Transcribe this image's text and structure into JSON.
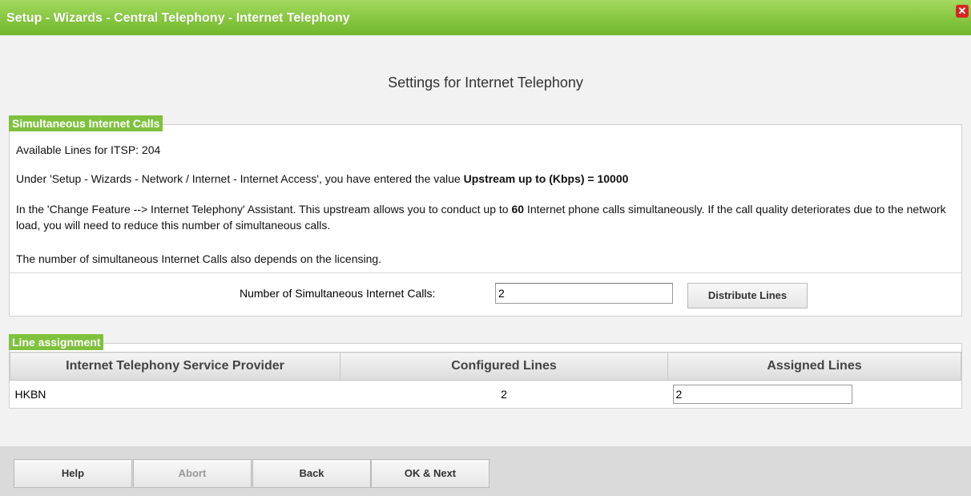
{
  "window": {
    "title": "Setup - Wizards - Central Telephony - Internet Telephony",
    "close_glyph": "✕"
  },
  "heading": "Settings for Internet Telephony",
  "simultaneous": {
    "legend": "Simultaneous Internet Calls",
    "available_lines": "Available Lines for ITSP: 204",
    "upstream_prefix": "Under 'Setup - Wizards - Network / Internet - Internet Access', you have entered the value ",
    "upstream_bold": "Upstream up to (Kbps) = 10000",
    "assistant_prefix": "In the 'Change Feature --> Internet Telephony' Assistant. This upstream allows you to conduct up to ",
    "assistant_bold": "60",
    "assistant_suffix": " Internet phone calls simultaneously. If the call quality deteriorates due to the network load, you will need to reduce this number of simultaneous calls.",
    "licensing": "The number of simultaneous Internet Calls also depends on the licensing.",
    "calls_label": "Number of Simultaneous Internet Calls:",
    "calls_value": "2",
    "distribute_label": "Distribute Lines"
  },
  "line_assignment": {
    "legend": "Line assignment",
    "columns": [
      "Internet Telephony Service Provider",
      "Configured Lines",
      "Assigned Lines"
    ],
    "rows": [
      {
        "provider": "HKBN",
        "configured": "2",
        "assigned": "2"
      }
    ]
  },
  "footer": {
    "help": "Help",
    "abort": "Abort",
    "back": "Back",
    "ok_next": "OK & Next"
  },
  "colors": {
    "title_bar": "#86c63f",
    "legend": "#7fc13d",
    "close": "#d92323"
  }
}
